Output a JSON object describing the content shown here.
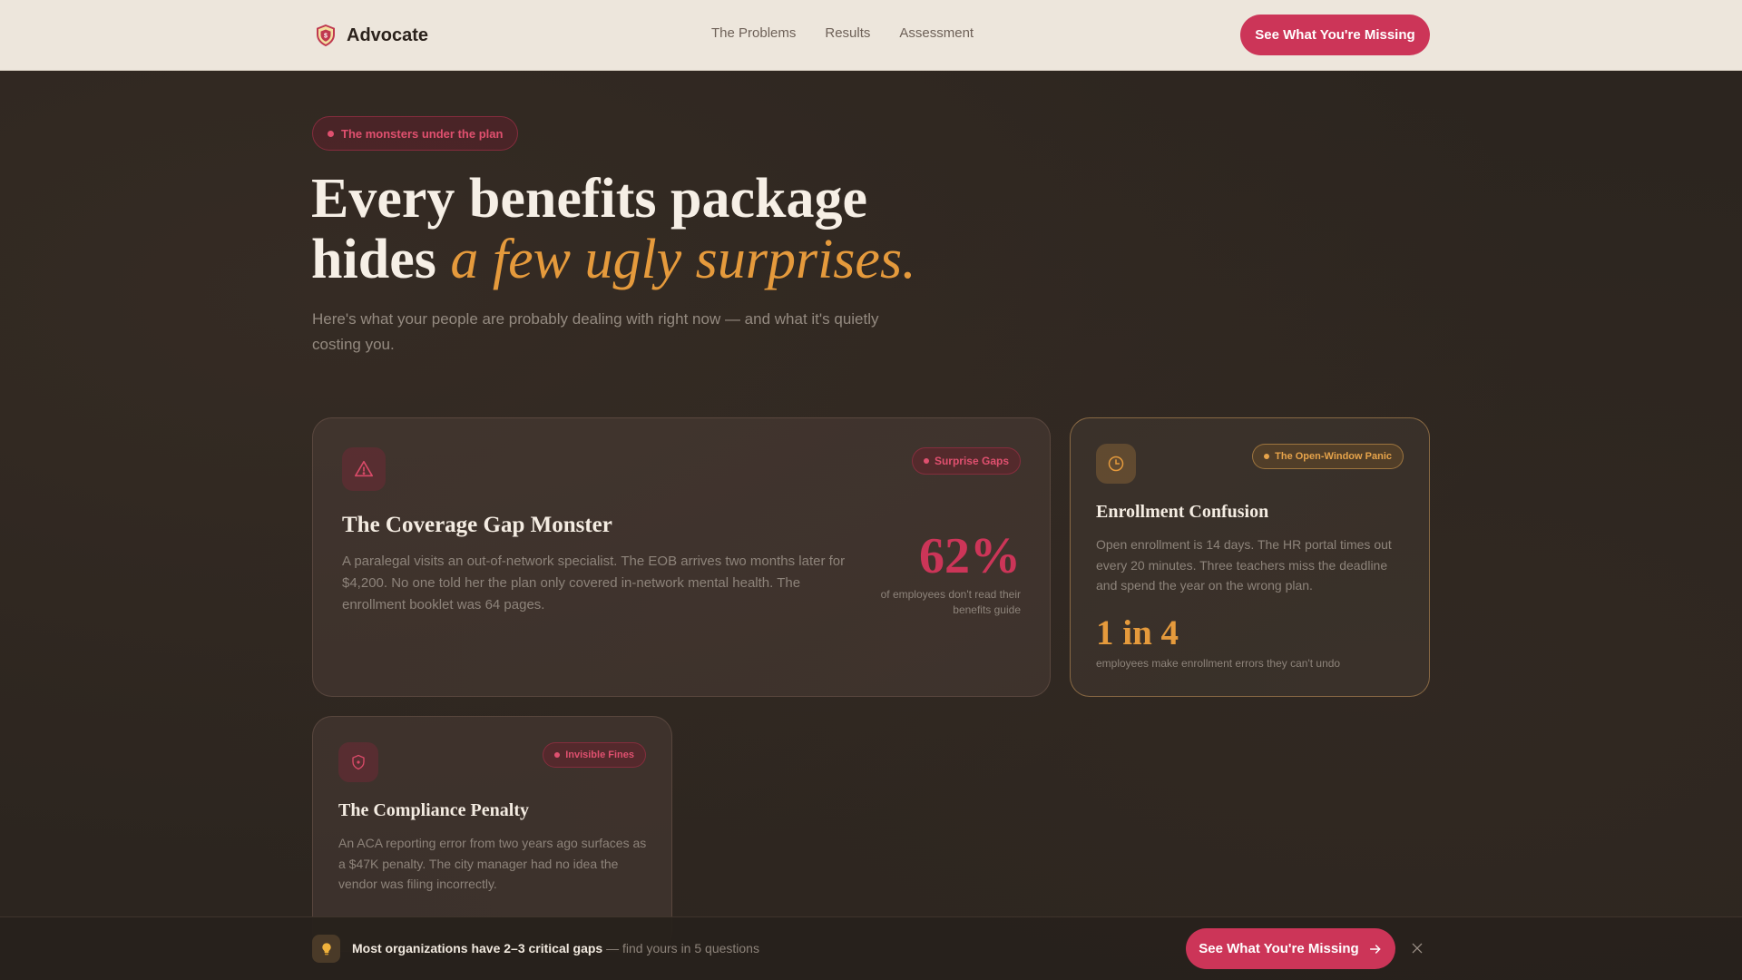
{
  "nav": {
    "brand": "Advocate",
    "links": [
      "The Problems",
      "Results",
      "Assessment"
    ],
    "cta": "See What You're Missing"
  },
  "hero": {
    "pill": "The monsters under the plan",
    "title_line1": "Every benefits package",
    "title_line2_plain": "hides ",
    "title_line2_accent": "a few ugly surprises.",
    "subtitle": "Here's what your people are probably dealing with right now — and what it's quietly costing you."
  },
  "cards": [
    {
      "tag": "Surprise Gaps",
      "title": "The Coverage Gap Monster",
      "body": "A paralegal visits an out-of-network specialist. The EOB arrives two months later for $4,200. No one told her the plan only covered in-network mental health. The enrollment booklet was 64 pages.",
      "stat": "62%",
      "stat_caption": "of employees don't read their benefits guide",
      "icon": "warning-triangle-icon"
    },
    {
      "tag": "The Open-Window Panic",
      "title": "Enrollment Confusion",
      "body": "Open enrollment is 14 days. The HR portal times out every 20 minutes. Three teachers miss the deadline and spend the year on the wrong plan.",
      "stat": "1 in 4",
      "stat_caption": "employees make enrollment errors they can't undo",
      "icon": "clock-icon"
    },
    {
      "tag": "Invisible Fines",
      "title": "The Compliance Penalty",
      "body": "An ACA reporting error from two years ago surfaces as a $47K penalty. The city manager had no idea the vendor was filing incorrectly.",
      "icon": "shield-icon"
    }
  ],
  "bottom_bar": {
    "bold": "Most organizations have 2–3 critical gaps",
    "rest": " — find yours in 5 questions",
    "cta": "See What You're Missing",
    "icon": "lightbulb-icon"
  },
  "colors": {
    "accent_red": "#cc3558",
    "accent_amber": "#e59a3c",
    "nav_bg": "#ede6dc",
    "page_bg": "#2c251f"
  }
}
